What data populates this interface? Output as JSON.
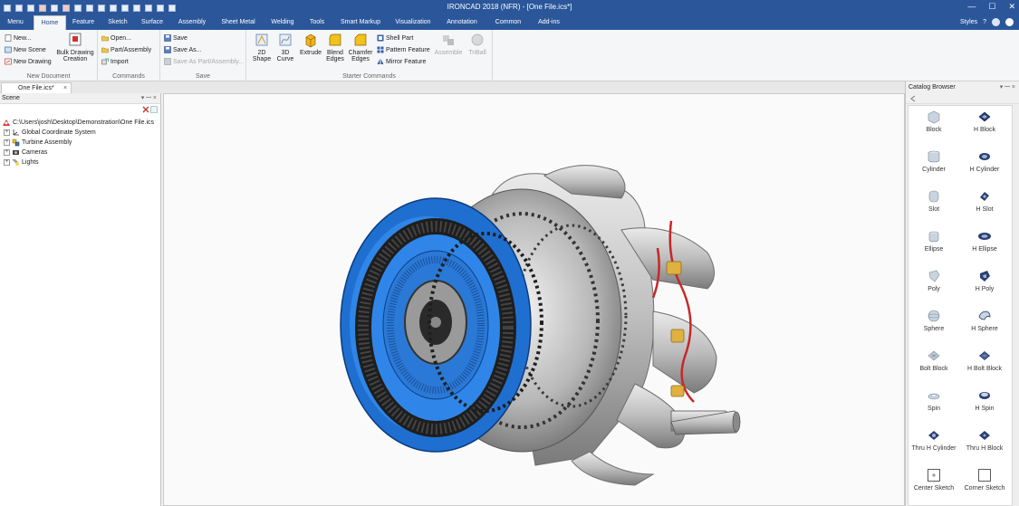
{
  "titlebar": {
    "title": "IRONCAD 2018 (NFR) - [One File.ics*]",
    "minimize_glyph": "—",
    "maximize_glyph": "☐",
    "close_glyph": "✕"
  },
  "tabs": [
    "Menu",
    "Home",
    "Feature",
    "Sketch",
    "Surface",
    "Assembly",
    "Sheet Metal",
    "Welding",
    "Tools",
    "Smart Markup",
    "Visualization",
    "Annotation",
    "Common",
    "Add-ins"
  ],
  "active_tab": "Home",
  "styles": {
    "label": "Styles",
    "help_glyph": "?"
  },
  "ribbon": {
    "new_document": {
      "label": "New Document",
      "new": "New...",
      "new_scene": "New Scene",
      "new_drawing": "New Drawing",
      "bulk_line1": "Bulk Drawing",
      "bulk_line2": "Creation"
    },
    "commands": {
      "label": "Commands",
      "open": "Open...",
      "part_assembly": "Part/Assembly",
      "import": "Import"
    },
    "save": {
      "label": "Save",
      "save": "Save",
      "save_as": "Save As...",
      "save_as_part": "Save As Part/Assembly..."
    },
    "starter": {
      "label": "Starter Commands",
      "shape_2d_line1": "2D",
      "shape_2d_line2": "Shape",
      "curve_3d_line1": "3D",
      "curve_3d_line2": "Curve",
      "extrude": "Extrude",
      "blend_line1": "Blend",
      "blend_line2": "Edges",
      "chamfer_line1": "Chamfer",
      "chamfer_line2": "Edges",
      "shell_part": "Shell Part",
      "pattern_feature": "Pattern Feature",
      "mirror_feature": "Mirror Feature",
      "assemble": "Assemble",
      "triball": "TriBall"
    }
  },
  "doc_tab": {
    "label": "One File.ics*",
    "close_glyph": "×"
  },
  "scene": {
    "title": "Scene",
    "pin_glyph": "▾ ꟷ ×",
    "root_path": "C:\\Users\\josh\\Desktop\\Demonstration\\One File.ics",
    "items": [
      "Global Coordinate System",
      "Turbine Assembly",
      "Cameras",
      "Lights"
    ]
  },
  "catalog": {
    "title": "Catalog Browser",
    "items": [
      {
        "label": "Block",
        "icon": "block-icon"
      },
      {
        "label": "H Block",
        "icon": "h-block-icon"
      },
      {
        "label": "Cylinder",
        "icon": "cylinder-icon"
      },
      {
        "label": "H Cylinder",
        "icon": "h-cylinder-icon"
      },
      {
        "label": "Slot",
        "icon": "slot-icon"
      },
      {
        "label": "H Slot",
        "icon": "h-slot-icon"
      },
      {
        "label": "Ellipse",
        "icon": "ellipse-icon"
      },
      {
        "label": "H Ellipse",
        "icon": "h-ellipse-icon"
      },
      {
        "label": "Poly",
        "icon": "poly-icon"
      },
      {
        "label": "H Poly",
        "icon": "h-poly-icon"
      },
      {
        "label": "Sphere",
        "icon": "sphere-icon"
      },
      {
        "label": "H Sphere",
        "icon": "h-sphere-icon"
      },
      {
        "label": "Bolt Block",
        "icon": "bolt-block-icon"
      },
      {
        "label": "H Bolt Block",
        "icon": "h-bolt-block-icon"
      },
      {
        "label": "Spin",
        "icon": "spin-icon"
      },
      {
        "label": "H Spin",
        "icon": "h-spin-icon"
      },
      {
        "label": "Thru H Cylinder",
        "icon": "thru-h-cylinder-icon"
      },
      {
        "label": "Thru H Block",
        "icon": "thru-h-block-icon"
      },
      {
        "label": "Center Sketch",
        "icon": "center-sketch-icon"
      },
      {
        "label": "Corner Sketch",
        "icon": "corner-sketch-icon"
      }
    ]
  },
  "colors": {
    "titlebar": "#2b579a",
    "ribbon": "#f5f6f7",
    "turbine_blue": "#1f6fd1",
    "accent_red": "#c62828"
  }
}
